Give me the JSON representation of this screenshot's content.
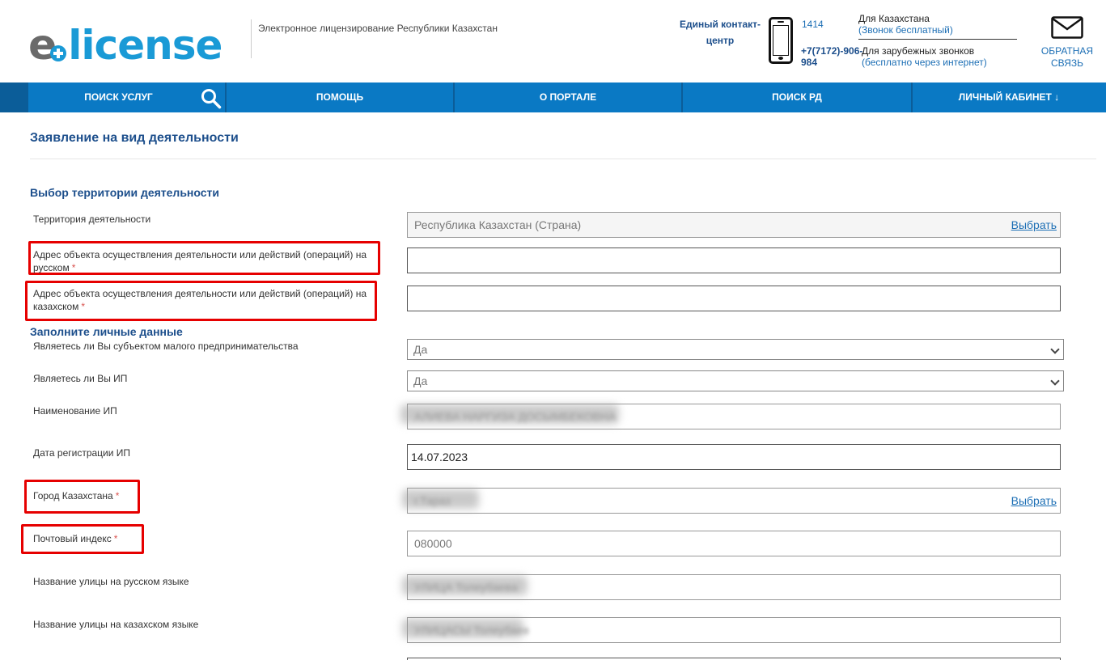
{
  "header": {
    "logo_prefix": "e",
    "logo_word": "license",
    "tagline": "Электронное лицензирование Республики Казахстан",
    "contact_title": "Единый контакт-центр",
    "phone_short": "1414",
    "phone_intl": "+7(7172)-906-984",
    "kz_label": "Для Казахстана",
    "kz_sub": "(Звонок бесплатный)",
    "intl_label": "Для зарубежных звонков",
    "intl_sub": "(бесплатно через интернет)",
    "feedback_label": "ОБРАТНАЯ СВЯЗЬ",
    "icons": [
      "phone-icon",
      "envelope-icon",
      "search-icon"
    ]
  },
  "nav": {
    "search_services": "Поиск услуг",
    "help": "Помощь",
    "about": "О портале",
    "search_rd": "Поиск РД",
    "cabinet": "Личный кабинет ↓"
  },
  "page": {
    "title": "Заявление на вид деятельности",
    "section_territory": "Выбор территории деятельности",
    "section_personal": "Заполните личные данные"
  },
  "form": {
    "territory": {
      "label": "Территория деятельности",
      "value": "Республика  Казахстан (Страна)",
      "link": "Выбрать"
    },
    "address_ru": {
      "label": "Адрес объекта осуществления деятельности или действий (операций) на русском",
      "req": "*",
      "value": ""
    },
    "address_kz": {
      "label": "Адрес объекта осуществления деятельности или действий (операций) на казахском",
      "req": "*",
      "value": ""
    },
    "small_business": {
      "label": "Являетесь ли Вы субъектом малого предпринимательства",
      "value": "Да"
    },
    "is_ip": {
      "label": "Являетесь ли Вы ИП",
      "value": "Да"
    },
    "ip_name": {
      "label": "Наименование ИП",
      "value": "АЛИЕВА НАРГИЗА ДОСЫМБЕКОВНА"
    },
    "ip_reg_date": {
      "label": "Дата регистрации ИП",
      "value": "14.07.2023"
    },
    "city": {
      "label": "Город Казахстана",
      "req": "*",
      "value": "г.Тараз",
      "link": "Выбрать"
    },
    "postal_code": {
      "label": "Почтовый индекс",
      "req": "*",
      "value": "080000"
    },
    "street_ru": {
      "label": "Название улицы на русском языке",
      "value": "УЛИЦА Толеубаева"
    },
    "street_kz": {
      "label": "Название улицы на казахском языке",
      "value": "УЛИЦАСЫ Толеубаев"
    }
  },
  "colors": {
    "brand_blue": "#0a79c4",
    "title_blue": "#1d4f8c",
    "highlight_red": "#e60000"
  }
}
